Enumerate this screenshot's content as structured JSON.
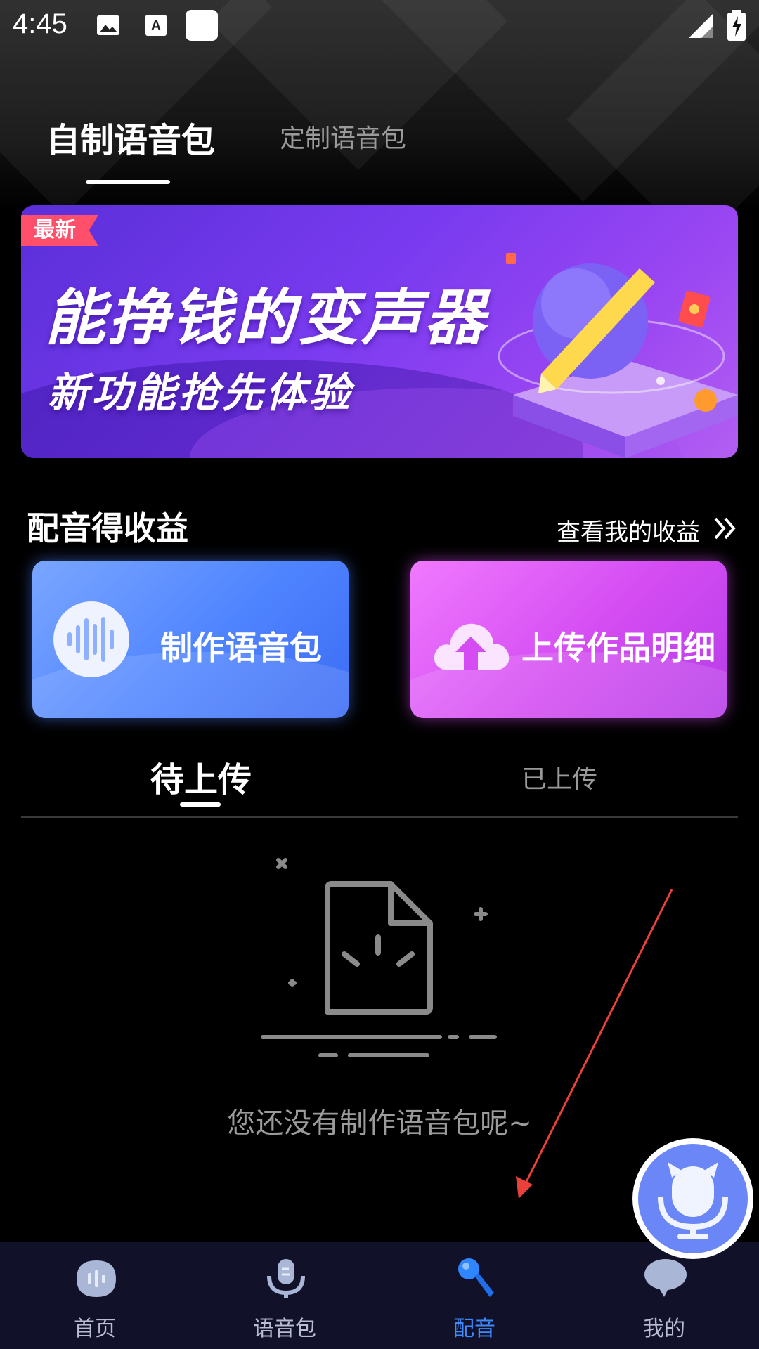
{
  "status_bar": {
    "time": "4:45",
    "icons": [
      "image-icon",
      "text-a-icon",
      "blank-square-icon",
      "signal-icon",
      "battery-charging-icon"
    ]
  },
  "top_tabs": [
    {
      "label": "自制语音包",
      "active": true
    },
    {
      "label": "定制语音包",
      "active": false
    }
  ],
  "banner": {
    "tag": "最新",
    "title": "能挣钱的变声器",
    "subtitle": "新功能抢先体验",
    "colors": {
      "start": "#5a2fd8",
      "end": "#b35ef2",
      "tag": "#ff4f6b"
    }
  },
  "earnings": {
    "title": "配音得收益",
    "link_label": "查看我的收益",
    "link_icon": "double-chevron-right-icon"
  },
  "action_cards": [
    {
      "label": "制作语音包",
      "icon": "sound-wave-icon",
      "color": "#4f84ff"
    },
    {
      "label": "上传作品明细",
      "icon": "cloud-upload-icon",
      "color": "#d44cf2"
    }
  ],
  "sub_tabs": [
    {
      "label": "待上传",
      "active": true
    },
    {
      "label": "已上传",
      "active": false
    }
  ],
  "empty_state": {
    "icon": "empty-document-icon",
    "message": "您还没有制作语音包呢~"
  },
  "fab": {
    "icon": "microphone-mascot-icon",
    "color": "#6b86f6"
  },
  "bottom_nav": [
    {
      "label": "首页",
      "icon": "home-wave-icon",
      "active": false
    },
    {
      "label": "语音包",
      "icon": "microphone-pack-icon",
      "active": false
    },
    {
      "label": "配音",
      "icon": "microphone-icon",
      "active": true
    },
    {
      "label": "我的",
      "icon": "chat-bubble-icon",
      "active": false
    }
  ],
  "accent_color": "#3d8bff",
  "annotation_color": "#e8413a"
}
